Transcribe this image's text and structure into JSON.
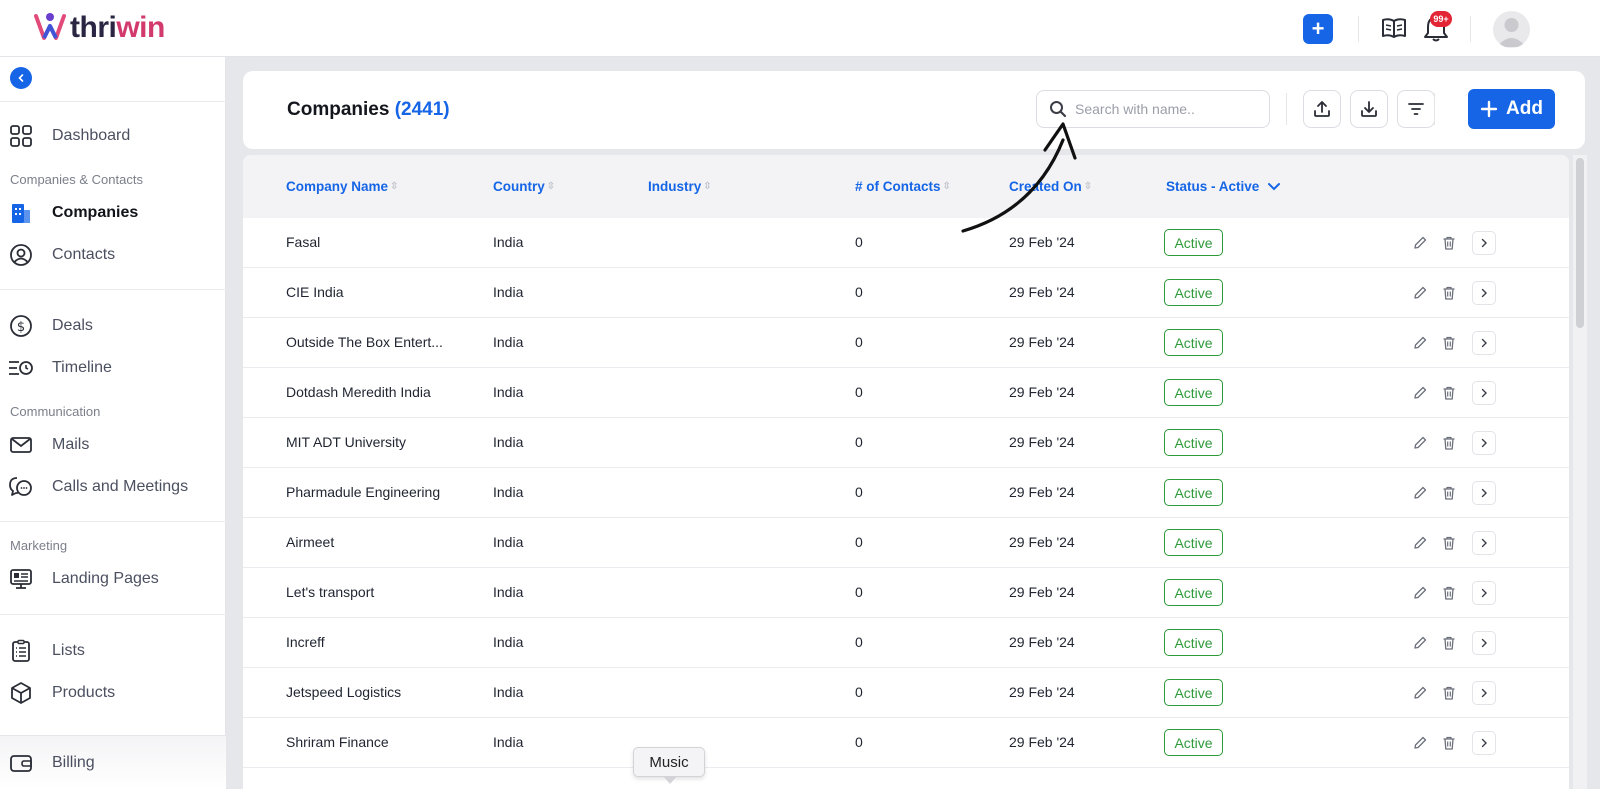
{
  "brand": {
    "name_part1": "thri",
    "name_part2": "win"
  },
  "topbar": {
    "notification_count": "99+"
  },
  "sidebar": {
    "items_top": [
      {
        "label": "Dashboard",
        "icon": "dashboard-grid-icon"
      }
    ],
    "section_companies": "Companies & Contacts",
    "items_companies": [
      {
        "label": "Companies",
        "icon": "building-icon"
      },
      {
        "label": "Contacts",
        "icon": "user-circle-icon"
      }
    ],
    "items_mid": [
      {
        "label": "Deals",
        "icon": "dollar-circle-icon"
      },
      {
        "label": "Timeline",
        "icon": "timeline-clock-icon"
      }
    ],
    "section_communication": "Communication",
    "items_communication": [
      {
        "label": "Mails",
        "icon": "mail-icon"
      },
      {
        "label": "Calls and Meetings",
        "icon": "chat-bubbles-icon"
      }
    ],
    "section_marketing": "Marketing",
    "items_marketing": [
      {
        "label": "Landing Pages",
        "icon": "monitor-icon"
      }
    ],
    "items_bottom": [
      {
        "label": "Lists",
        "icon": "list-icon"
      },
      {
        "label": "Products",
        "icon": "box-icon"
      }
    ],
    "billing": {
      "label": "Billing",
      "icon": "wallet-icon"
    }
  },
  "header": {
    "title": "Companies",
    "count": "(2441)",
    "search_placeholder": "Search with name..",
    "add_label": "Add"
  },
  "table": {
    "columns": {
      "company": "Company Name",
      "country": "Country",
      "industry": "Industry",
      "contacts": "# of Contacts",
      "created": "Created On",
      "status": "Status - Active"
    },
    "rows": [
      {
        "company": "Fasal",
        "country": "India",
        "industry": "",
        "contacts": "0",
        "created": "29 Feb '24",
        "status": "Active"
      },
      {
        "company": "CIE India",
        "country": "India",
        "industry": "",
        "contacts": "0",
        "created": "29 Feb '24",
        "status": "Active"
      },
      {
        "company": "Outside The Box Entert...",
        "country": "India",
        "industry": "",
        "contacts": "0",
        "created": "29 Feb '24",
        "status": "Active"
      },
      {
        "company": "Dotdash Meredith India",
        "country": "India",
        "industry": "",
        "contacts": "0",
        "created": "29 Feb '24",
        "status": "Active"
      },
      {
        "company": "MIT ADT University",
        "country": "India",
        "industry": "",
        "contacts": "0",
        "created": "29 Feb '24",
        "status": "Active"
      },
      {
        "company": "Pharmadule Engineering",
        "country": "India",
        "industry": "",
        "contacts": "0",
        "created": "29 Feb '24",
        "status": "Active"
      },
      {
        "company": "Airmeet",
        "country": "India",
        "industry": "",
        "contacts": "0",
        "created": "29 Feb '24",
        "status": "Active"
      },
      {
        "company": "Let's transport",
        "country": "India",
        "industry": "",
        "contacts": "0",
        "created": "29 Feb '24",
        "status": "Active"
      },
      {
        "company": "Increff",
        "country": "India",
        "industry": "",
        "contacts": "0",
        "created": "29 Feb '24",
        "status": "Active"
      },
      {
        "company": "Jetspeed Logistics",
        "country": "India",
        "industry": "",
        "contacts": "0",
        "created": "29 Feb '24",
        "status": "Active"
      },
      {
        "company": "Shriram Finance",
        "country": "India",
        "industry": "",
        "contacts": "0",
        "created": "29 Feb '24",
        "status": "Active"
      }
    ]
  },
  "tooltip": {
    "text": "Music"
  },
  "colors": {
    "accent": "#1565e6",
    "active_green": "#2e9a3a",
    "badge_red": "#e32636"
  }
}
